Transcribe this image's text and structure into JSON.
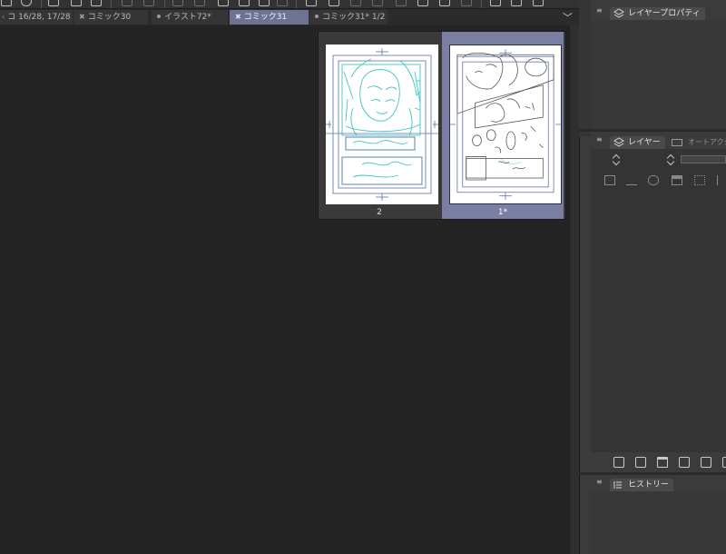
{
  "toolbar": {
    "icons": [
      "new-icon",
      "add-icon",
      "save-icon",
      "layout-icon",
      "export-icon",
      "undo-icon",
      "redo-icon",
      "select-icon",
      "rotate-icon",
      "fill-icon",
      "transform-icon",
      "check-icon",
      "snap-icon",
      "clip-icon",
      "ruler-icon",
      "panel-icon",
      "text-icon",
      "shape-icon",
      "cut-icon",
      "paste-icon",
      "marker-icon"
    ]
  },
  "tabs": [
    {
      "label": "コ 16/28, 17/28",
      "marker": "‹",
      "active": false
    },
    {
      "label": "コミック30",
      "marker": "✖",
      "active": false
    },
    {
      "label": "イラスト72*",
      "marker": "●",
      "active": false
    },
    {
      "label": "コミック31",
      "marker": "✖",
      "active": true
    },
    {
      "label": "コミック31* 1/2",
      "marker": "●",
      "active": false
    }
  ],
  "tab_overflow": "﹀",
  "pages": [
    {
      "label": "2",
      "selected": false
    },
    {
      "label": "1*",
      "selected": true
    }
  ],
  "panels": {
    "layer_property": {
      "title": "レイヤープロパティ"
    },
    "layer": {
      "title": "レイヤー",
      "secondary_tab": "オートアクション"
    },
    "history": {
      "title": "ヒストリー"
    }
  },
  "colors": {
    "active_tab": "#6e7393",
    "selected_page": "#7a7fa3",
    "sketch_cyan": "#3fc4c4",
    "sketch_blue": "#5b6fa6"
  }
}
